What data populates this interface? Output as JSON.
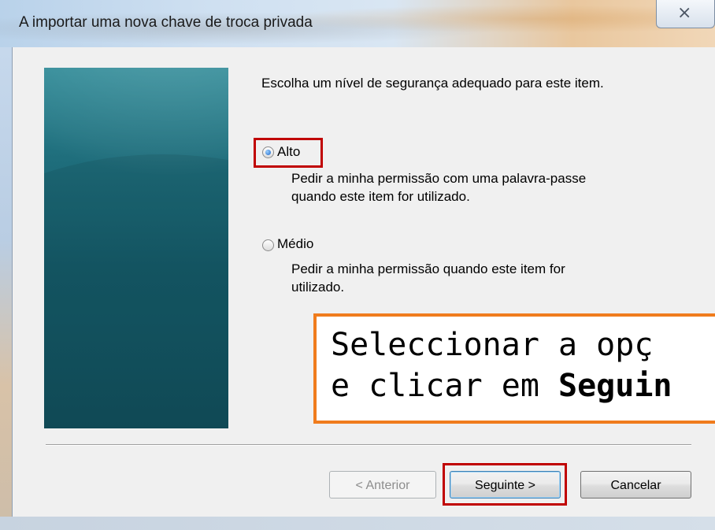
{
  "window": {
    "title": "A importar uma nova chave de troca privada",
    "close_icon": "close-icon",
    "close_glyph": "⨯"
  },
  "content": {
    "heading": "Escolha um nível de segurança adequado para este item.",
    "options": [
      {
        "label": "Alto",
        "description_line1": "Pedir a minha permissão com uma palavra-passe",
        "description_line2": "quando este item for utilizado.",
        "selected": true
      },
      {
        "label": "Médio",
        "description_line1": "Pedir a minha permissão quando este item for",
        "description_line2": "utilizado.",
        "selected": false
      }
    ]
  },
  "buttons": {
    "back": "< Anterior",
    "next": "Seguinte >",
    "cancel": "Cancelar"
  },
  "callout": {
    "line1": "Seleccionar a opç",
    "line2_prefix": "e clicar em ",
    "line2_bold": "Seguin"
  },
  "colors": {
    "highlight": "#c00000",
    "callout_border": "#f07c1d",
    "side_image": "#155c6a"
  }
}
